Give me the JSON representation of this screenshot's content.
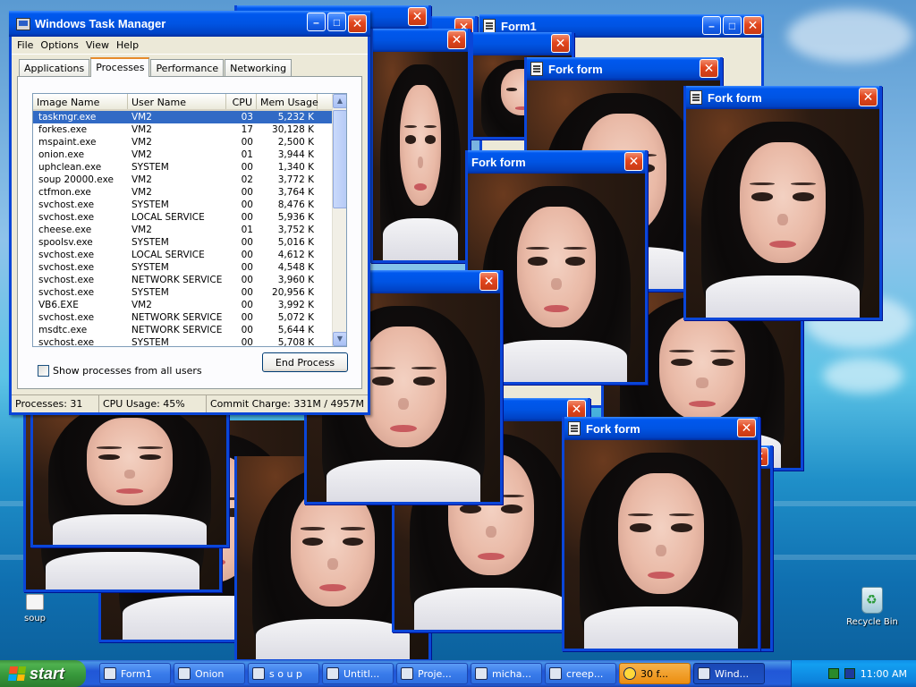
{
  "task_manager": {
    "title": "Windows Task Manager",
    "menu": [
      "File",
      "Options",
      "View",
      "Help"
    ],
    "tabs": [
      "Applications",
      "Processes",
      "Performance",
      "Networking"
    ],
    "active_tab": "Processes",
    "columns": [
      "Image Name",
      "User Name",
      "CPU",
      "Mem Usage"
    ],
    "rows": [
      [
        "taskmgr.exe",
        "VM2",
        "03",
        "5,232 K"
      ],
      [
        "forkes.exe",
        "VM2",
        "17",
        "30,128 K"
      ],
      [
        "mspaint.exe",
        "VM2",
        "00",
        "2,500 K"
      ],
      [
        "onion.exe",
        "VM2",
        "01",
        "3,944 K"
      ],
      [
        "uphclean.exe",
        "SYSTEM",
        "00",
        "1,340 K"
      ],
      [
        "soup 20000.exe",
        "VM2",
        "02",
        "3,772 K"
      ],
      [
        "ctfmon.exe",
        "VM2",
        "00",
        "3,764 K"
      ],
      [
        "svchost.exe",
        "SYSTEM",
        "00",
        "8,476 K"
      ],
      [
        "svchost.exe",
        "LOCAL SERVICE",
        "00",
        "5,936 K"
      ],
      [
        "cheese.exe",
        "VM2",
        "01",
        "3,752 K"
      ],
      [
        "spoolsv.exe",
        "SYSTEM",
        "00",
        "5,016 K"
      ],
      [
        "svchost.exe",
        "LOCAL SERVICE",
        "00",
        "4,612 K"
      ],
      [
        "svchost.exe",
        "SYSTEM",
        "00",
        "4,548 K"
      ],
      [
        "svchost.exe",
        "NETWORK SERVICE",
        "00",
        "3,960 K"
      ],
      [
        "svchost.exe",
        "SYSTEM",
        "00",
        "20,956 K"
      ],
      [
        "VB6.EXE",
        "VM2",
        "00",
        "3,992 K"
      ],
      [
        "svchost.exe",
        "NETWORK SERVICE",
        "00",
        "5,072 K"
      ],
      [
        "msdtc.exe",
        "NETWORK SERVICE",
        "00",
        "5,644 K"
      ],
      [
        "svchost.exe",
        "SYSTEM",
        "00",
        "5,708 K"
      ]
    ],
    "show_all_label": "Show processes from all users",
    "end_process_label": "End Process",
    "status": {
      "processes": "Processes: 31",
      "cpu": "CPU Usage: 45%",
      "commit": "Commit Charge: 331M / 4957M"
    }
  },
  "fork_form_title": "Fork form",
  "form1_title": "Form1",
  "close_glyph": "✕",
  "desktop_icons": {
    "soup": "soup",
    "recycle_bin": "Recycle Bin"
  },
  "taskbar": {
    "start_label": "start",
    "buttons": [
      "Form1",
      "Onion",
      "s o u p",
      "Untitl...",
      "Proje...",
      "micha...",
      "creep...",
      "30 f...",
      "Wind..."
    ],
    "clock": "11:00 AM"
  },
  "colors": {
    "xp_blue": "#0a46d8",
    "close_red": "#e2461e",
    "selection": "#316ac5"
  }
}
